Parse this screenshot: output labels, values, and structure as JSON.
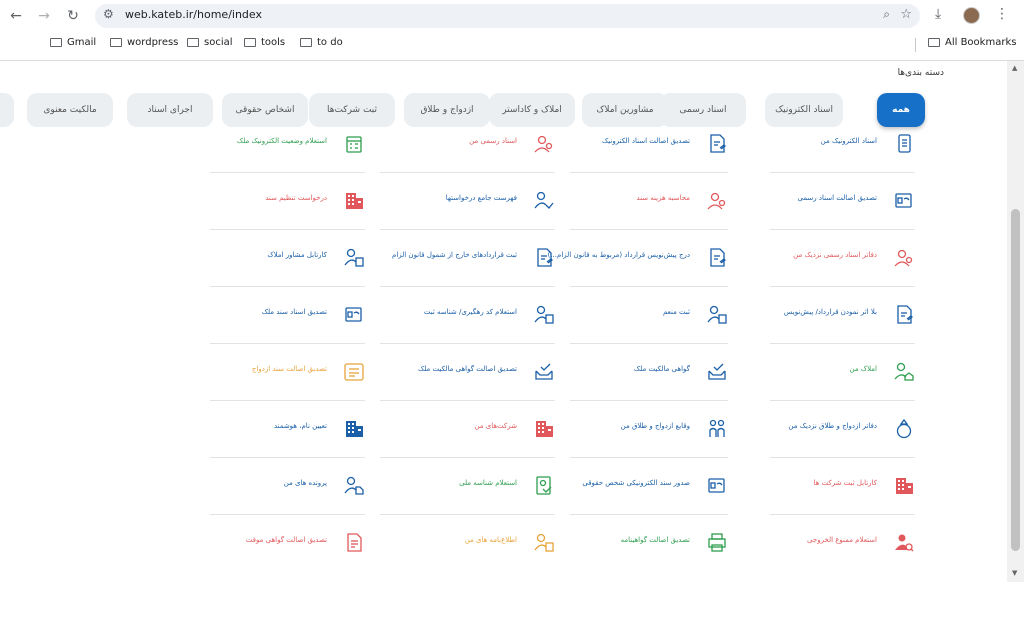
{
  "browser": {
    "url": "web.kateb.ir/home/index",
    "bookmarks": [
      "Gmail",
      "wordpress",
      "social",
      "tools",
      "to do"
    ],
    "all_bookmarks_label": "All Bookmarks"
  },
  "page": {
    "categories_title": "دسته بندی‌ها",
    "tabs": [
      {
        "label": "همه",
        "active": true
      },
      {
        "label": "اسناد الکترونیک",
        "active": false
      },
      {
        "label": "اسناد رسمی",
        "active": false
      },
      {
        "label": "مشاورین املاک",
        "active": false
      },
      {
        "label": "املاک و کاداستر",
        "active": false
      },
      {
        "label": "ازدواج و طلاق",
        "active": false
      },
      {
        "label": "ثبت شرکت‌ها",
        "active": false
      },
      {
        "label": "اشخاص حقوقی",
        "active": false
      },
      {
        "label": "اجرای اسناد",
        "active": false
      },
      {
        "label": "مالکیت معنوی",
        "active": false
      }
    ],
    "services": [
      [
        {
          "label": "اسناد الکترونیک من",
          "color": "#1a5fa8",
          "icon": "document-icon"
        },
        {
          "label": "تصدیق اصالت اسناد رسمی",
          "color": "#1a5fa8",
          "icon": "certificate-icon"
        },
        {
          "label": "دفاتر اسناد رسمی نزدیک من",
          "color": "#e0585b",
          "icon": "person-location-icon"
        },
        {
          "label": "بلا اثر نمودن قرارداد/ پیش‌نویس",
          "color": "#1a5fa8",
          "icon": "document-edit-icon"
        },
        {
          "label": "املاک من",
          "color": "#2e9e4f",
          "icon": "person-home-icon"
        },
        {
          "label": "دفاتر ازدواج و طلاق نزدیک من",
          "color": "#1a5fa8",
          "icon": "ring-icon"
        },
        {
          "label": "کارتابل ثبت شرکت ها",
          "color": "#e0585b",
          "icon": "building-grid-icon"
        },
        {
          "label": "استعلام ممنوع الخروجی",
          "color": "#e0585b",
          "icon": "person-search-icon"
        }
      ],
      [
        {
          "label": "تصدیق اصالت اسناد الکترونیک",
          "color": "#1a5fa8",
          "icon": "document-edit-icon"
        },
        {
          "label": "محاسبه هزینه سند",
          "color": "#e0585b",
          "icon": "person-location-icon"
        },
        {
          "label": "درج پیش‌نویس قرارداد (مربوط به قانون الزام...)",
          "color": "#1a5fa8",
          "icon": "document-edit-icon"
        },
        {
          "label": "ثبت منعم",
          "color": "#1a5fa8",
          "icon": "person-doc-icon"
        },
        {
          "label": "گواهی مالکیت ملک",
          "color": "#1a5fa8",
          "icon": "inbox-check-icon"
        },
        {
          "label": "وقایع ازدواج و طلاق من",
          "color": "#1a5fa8",
          "icon": "couple-icon"
        },
        {
          "label": "صدور سند الکترونیکی شخص حقوقی",
          "color": "#1a5fa8",
          "icon": "certificate-icon"
        },
        {
          "label": "تصدیق اصالت گواهینامه",
          "color": "#2e9e4f",
          "icon": "printer-icon"
        }
      ],
      [
        {
          "label": "اسناد رسمی من",
          "color": "#e0585b",
          "icon": "person-location-icon"
        },
        {
          "label": "فهرست جامع درخواستها",
          "color": "#1a5fa8",
          "icon": "person-check-icon"
        },
        {
          "label": "ثبت قراردادهای خارج از شمول قانون الزام",
          "color": "#1a5fa8",
          "icon": "document-edit-icon"
        },
        {
          "label": "استعلام کد رهگیری/ شناسه ثبت",
          "color": "#1a5fa8",
          "icon": "person-doc-icon"
        },
        {
          "label": "تصدیق اصالت گواهی مالکیت ملک",
          "color": "#1a5fa8",
          "icon": "inbox-check-icon"
        },
        {
          "label": "شرکت‌های من",
          "color": "#e0585b",
          "icon": "building-grid-icon"
        },
        {
          "label": "استعلام شناسه ملی",
          "color": "#2e9e4f",
          "icon": "id-check-icon"
        },
        {
          "label": "اطلاع‌نامه های من",
          "color": "#e8a33a",
          "icon": "person-doc-icon"
        }
      ],
      [
        {
          "label": "استعلام وضعیت الکترونیک ملک",
          "color": "#2e9e4f",
          "icon": "calendar-icon"
        },
        {
          "label": "درخواست تنظیم سند",
          "color": "#e0585b",
          "icon": "building-grid-icon"
        },
        {
          "label": "کارتابل مشاور املاک",
          "color": "#1a5fa8",
          "icon": "person-doc-icon"
        },
        {
          "label": "تصدیق اسناد سند ملک",
          "color": "#1a5fa8",
          "icon": "certificate-icon"
        },
        {
          "label": "تصدیق اصالت سند ازدواج",
          "color": "#e8a33a",
          "icon": "id-card-icon"
        },
        {
          "label": "تعیین نام، هوشمند",
          "color": "#1a5fa8",
          "icon": "building-grid-icon"
        },
        {
          "label": "پرونده های من",
          "color": "#1a5fa8",
          "icon": "person-file-icon"
        },
        {
          "label": "تصدیق اصالت گواهی موقت",
          "color": "#e0585b",
          "icon": "document-lines-icon"
        }
      ]
    ]
  }
}
